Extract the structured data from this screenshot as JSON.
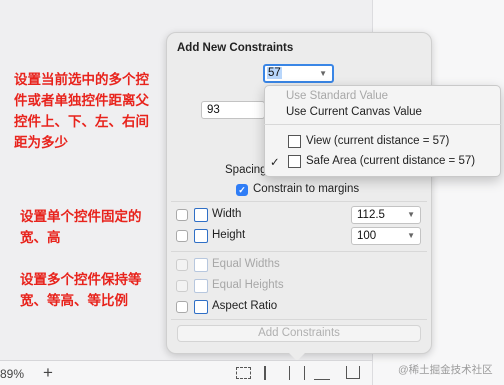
{
  "annotations": {
    "note1": "设置当前选中的多个控\n件或者单独控件距离父\n控件上、下、左、右间\n距为多少",
    "note2": "设置单个控件固定的\n宽、高",
    "note3": "设置多个控件保持等\n宽、等高、等比例"
  },
  "popover": {
    "title": "Add New Constraints",
    "top_value": "57",
    "left_value": "93",
    "spacing_label": "Spacing",
    "constrain_margins_label": "Constrain to margins",
    "width_label": "Width",
    "width_value": "112.5",
    "height_label": "Height",
    "height_value": "100",
    "equal_widths_label": "Equal Widths",
    "equal_heights_label": "Equal Heights",
    "aspect_ratio_label": "Aspect Ratio",
    "add_button_label": "Add Constraints",
    "checkmark": "✓",
    "dropdown_arrow": "▼"
  },
  "menu": {
    "use_standard": "Use Standard Value",
    "use_canvas": "Use Current Canvas Value",
    "view_item": "View (current distance = 57)",
    "safe_area_item": "Safe Area (current distance = 57)",
    "checkmark": "✓"
  },
  "bottom": {
    "zoom": "89%",
    "add": "+"
  },
  "watermark": "@稀土掘金技术社区"
}
